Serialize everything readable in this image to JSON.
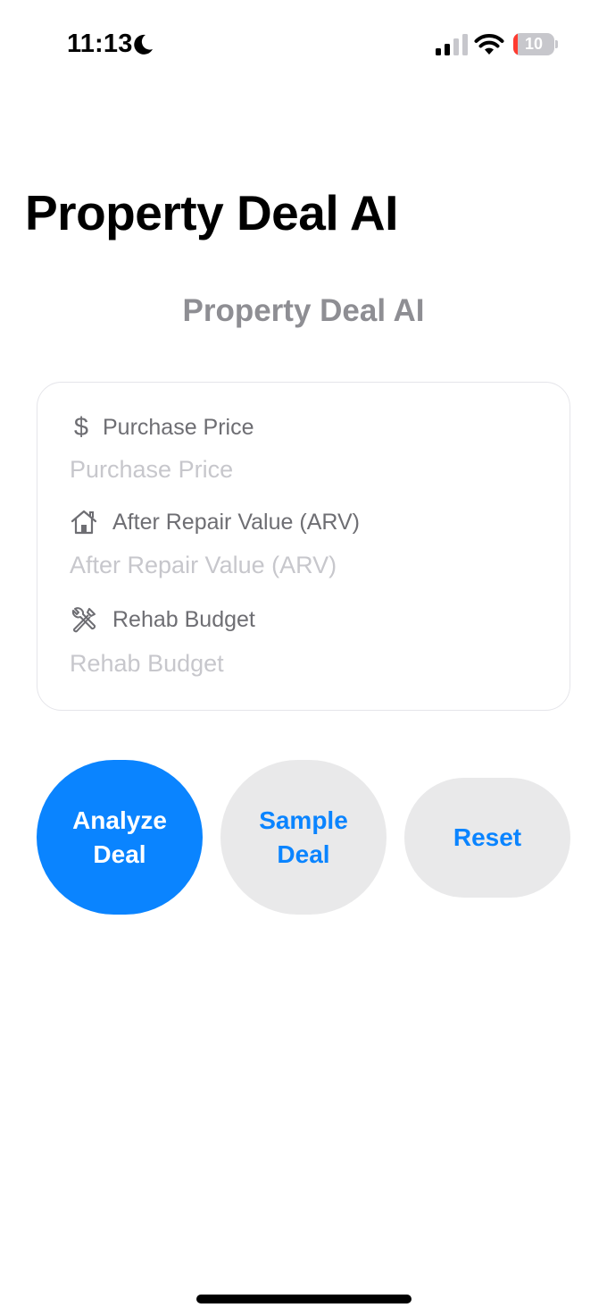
{
  "status_bar": {
    "time": "11:13",
    "focus_icon": "moon-icon",
    "signal_icon": "cellular-signal-icon",
    "wifi_icon": "wifi-icon",
    "battery_level": "10",
    "battery_fraction": 0.1
  },
  "nav": {
    "large_title": "Property Deal AI"
  },
  "main": {
    "subtitle": "Property Deal AI"
  },
  "form": {
    "fields": [
      {
        "icon": "dollar-sign-icon",
        "label": "Purchase Price",
        "placeholder": "Purchase Price",
        "value": ""
      },
      {
        "icon": "house-icon",
        "label": "After Repair Value (ARV)",
        "placeholder": "After Repair Value (ARV)",
        "value": ""
      },
      {
        "icon": "tools-icon",
        "label": "Rehab Budget",
        "placeholder": "Rehab Budget",
        "value": ""
      }
    ]
  },
  "actions": {
    "analyze_label": "Analyze\nDeal",
    "sample_label": "Sample\nDeal",
    "reset_label": "Reset"
  },
  "colors": {
    "accent": "#0a84ff",
    "secondary_button_bg": "#e9e9ea",
    "label_gray": "#6e6e73",
    "placeholder_gray": "#c7c7cc",
    "battery_low": "#ff3b30"
  }
}
